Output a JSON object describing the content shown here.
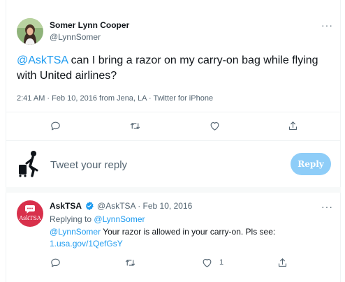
{
  "tweet": {
    "author_name": "Somer Lynn Cooper",
    "author_handle": "@LynnSomer",
    "mention": "@AskTSA",
    "text": " can I bring a razor on my carry-on bag while flying with United airlines?",
    "timestamp": "2:41 AM · Feb 10, 2016 from Jena, LA · Twitter for iPhone",
    "more": "···"
  },
  "actions": {
    "reply_icon": "comment-icon",
    "retweet_icon": "retweet-icon",
    "like_icon": "heart-icon",
    "share_icon": "share-icon"
  },
  "compose": {
    "placeholder": "Tweet your reply",
    "button": "Reply"
  },
  "reply": {
    "author_name": "AskTSA",
    "verified_icon": "verified-badge-icon",
    "meta": "@AskTSA · Feb 10, 2016",
    "more": "···",
    "replying_to_label": "Replying to",
    "replying_to_handle": "@LynnSomer",
    "mention": "@LynnSomer",
    "text": " Your razor is allowed in your carry-on. Pls see:",
    "link": "1.usa.gov/1QefGsY",
    "like_count": "1",
    "avatar_text": "AskTSA"
  },
  "colors": {
    "accent": "#1d9bf0",
    "reply_button": "#8ecdf8",
    "tsa_red": "#d8304b"
  }
}
